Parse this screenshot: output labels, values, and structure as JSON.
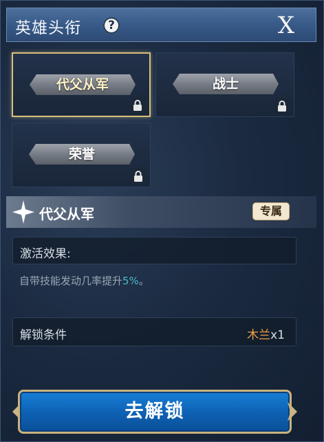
{
  "header": {
    "title": "英雄头衔",
    "help_icon": "?",
    "close_label": "X"
  },
  "titles": [
    {
      "label": "战士",
      "locked": true,
      "selected": false
    },
    {
      "label": "荣誉",
      "locked": true,
      "selected": false
    }
  ],
  "selected_title": {
    "label": "代父从军",
    "badge": "专属"
  },
  "selected_card": {
    "label": "代父从军",
    "locked": true
  },
  "effect": {
    "label": "激活效果:",
    "desc_prefix": "自带技能发动几率提升",
    "desc_value": "5%",
    "desc_suffix": "。"
  },
  "unlock": {
    "label": "解锁条件",
    "item": "木兰",
    "qty": "x1"
  },
  "button": {
    "label": "去解锁"
  },
  "colors": {
    "accent_gold": "#d9c07a",
    "highlight_cyan": "#49b9c6",
    "item_orange": "#f0a24a",
    "button_blue": "#0e62b5"
  }
}
